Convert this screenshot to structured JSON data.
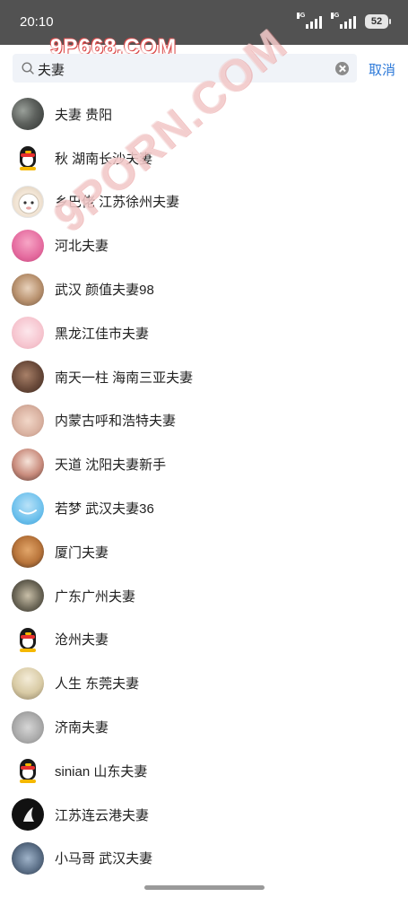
{
  "status_bar": {
    "time": "20:10",
    "signal_1_tag": "5G",
    "signal_2_tag": "5G",
    "battery": "52"
  },
  "watermark": {
    "top": "9P668.COM",
    "diagonal": "9PORN.COM"
  },
  "search": {
    "query": "夫妻",
    "cancel_label": "取消"
  },
  "contacts": [
    {
      "name": "夫妻  贵阳",
      "avatar": "photo-dark"
    },
    {
      "name": "秋 湖南长沙夫妻",
      "avatar": "penguin"
    },
    {
      "name": "乡巴佬 江苏徐州夫妻",
      "avatar": "cartoon-sheep"
    },
    {
      "name": "河北夫妻",
      "avatar": "photo-pink"
    },
    {
      "name": "武汉 颜值夫妻98",
      "avatar": "photo-woman"
    },
    {
      "name": "黑龙江佳市夫妻",
      "avatar": "photo-light-pink"
    },
    {
      "name": "南天一柱 海南三亚夫妻",
      "avatar": "photo-dark-brown"
    },
    {
      "name": "内蒙古呼和浩特夫妻",
      "avatar": "photo-skin"
    },
    {
      "name": "天道 沈阳夫妻新手",
      "avatar": "photo-portrait"
    },
    {
      "name": "若梦 武汉夫妻36",
      "avatar": "photo-sky"
    },
    {
      "name": "厦门夫妻",
      "avatar": "photo-dog"
    },
    {
      "name": "广东广州夫妻",
      "avatar": "photo-lace"
    },
    {
      "name": "沧州夫妻",
      "avatar": "penguin"
    },
    {
      "name": "人生 东莞夫妻",
      "avatar": "photo-beach"
    },
    {
      "name": "济南夫妻",
      "avatar": "photo-gray"
    },
    {
      "name": "sinian  山东夫妻",
      "avatar": "penguin"
    },
    {
      "name": "江苏连云港夫妻",
      "avatar": "photo-black-logo"
    },
    {
      "name": "小马哥 武汉夫妻",
      "avatar": "photo-crowd"
    }
  ],
  "colors": {
    "status_bar_bg": "#525252",
    "search_bg": "#f0f3f8",
    "accent": "#2e7ad9",
    "text": "#222222"
  }
}
